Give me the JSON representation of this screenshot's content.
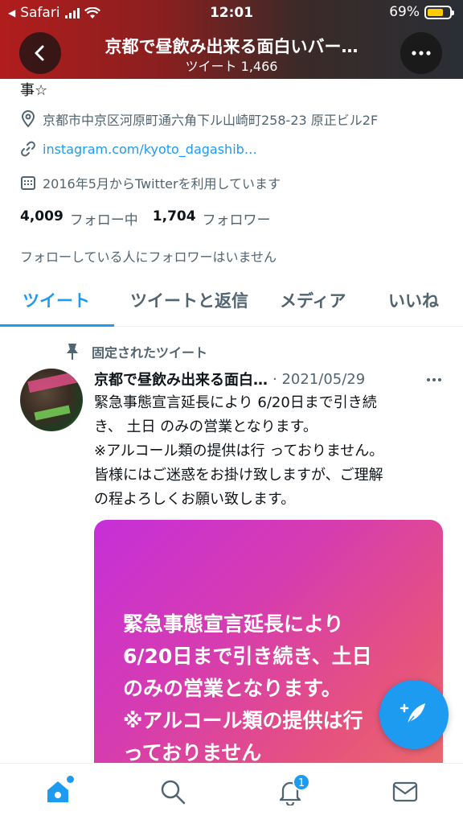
{
  "status_bar": {
    "carrier": "Safari",
    "time": "12:01",
    "battery": "69%"
  },
  "header": {
    "title": "京都で昼飲み出来る面白いバー…",
    "subtitle": "ツイート 1,466"
  },
  "profile": {
    "bio_fragment": "事☆",
    "location": "京都市中京区河原町通六角下ル山崎町258-23 原正ビル2F",
    "link": "instagram.com/kyoto_dagashib…",
    "joined": "2016年5月からTwitterを利用しています",
    "following_count": "4,009",
    "following_label": "フォロー中",
    "followers_count": "1,704",
    "followers_label": "フォロワー",
    "mutual_note": "フォローしている人にフォロワーはいません"
  },
  "tabs": [
    {
      "label": "ツイート"
    },
    {
      "label": "ツイートと返信"
    },
    {
      "label": "メディア"
    },
    {
      "label": "いいね"
    }
  ],
  "tweet": {
    "pinned_label": "固定されたツイート",
    "author": "京都で昼飲み出来る面白…",
    "date": "· 2021/05/29",
    "text_lines": [
      "緊急事態宣言延長により 6/20日まで引き続",
      "き、 土日 のみの営業となります。",
      "※アルコール類の提供は行 っておりません。",
      "皆様にはご迷惑をお掛け致しますが、ご理解",
      "の程よろしくお願い致します。"
    ],
    "media_text": "緊急事態宣言延長により\n6/20日まで引き続き、土日\nのみの営業となります。\n※アルコール類の提供は行\nっておりません"
  },
  "bottom_nav": {
    "notification_badge": "1"
  },
  "colors": {
    "accent": "#1d9bf0",
    "text": "#0f1419",
    "secondary": "#536471"
  },
  "icons": [
    "back-icon",
    "more-icon",
    "location-icon",
    "link-icon",
    "calendar-icon",
    "pin-icon",
    "compose-icon",
    "home-icon",
    "search-icon",
    "bell-icon",
    "mail-icon"
  ]
}
